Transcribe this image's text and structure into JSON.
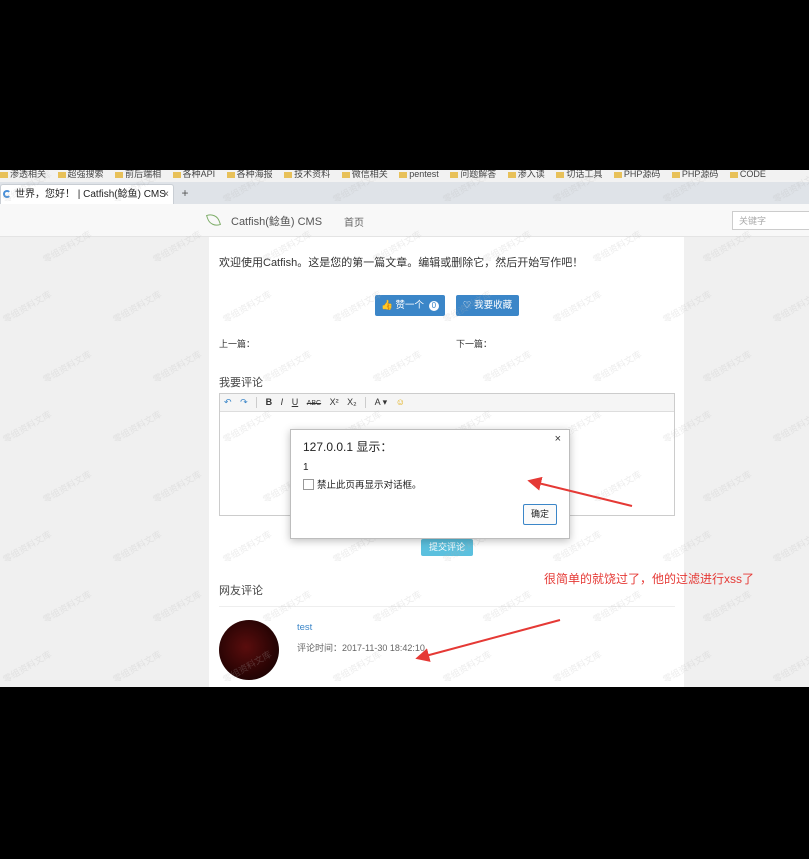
{
  "browser": {
    "bookmarks": [
      "渗透相关",
      "超强搜索",
      "前后端相",
      "各种API",
      "各种海报",
      "技术资料",
      "微信相关",
      "pentest",
      "问题解答",
      "渗入读",
      "切话工具",
      "PHP源码",
      "PHP源码",
      "CODE"
    ],
    "tab_title": "世界，您好！ | Catfish(鲶鱼) CMS",
    "tab_close": "×",
    "new_tab": "+"
  },
  "navbar": {
    "brand": "Catfish(鲶鱼) CMS",
    "home": "首页",
    "search_placeholder": "关键字"
  },
  "article": {
    "welcome_text": "欢迎使用Catfish。这是您的第一篇文章。编辑或删除它，然后开始写作吧！",
    "like_label": "赞一个",
    "like_count": "0",
    "favorite_label": "我要收藏",
    "prev_label": "上一篇：",
    "next_label": "下一篇："
  },
  "comment_form": {
    "heading": "我要评论",
    "toolbar": [
      "↶",
      "↷",
      "B",
      "I",
      "U",
      "ABC",
      "X²",
      "X₂",
      "A ▾",
      "☺"
    ],
    "submit_label": "提交评论"
  },
  "comments": {
    "heading": "网友评论",
    "items": [
      {
        "user": "test",
        "time": "评论时间：2017-11-30 18:42:10"
      }
    ]
  },
  "dialog": {
    "title": "127.0.0.1 显示：",
    "message": "1",
    "checkbox_label": "禁止此页再显示对话框。",
    "ok_label": "确定",
    "close": "×"
  },
  "annotation": {
    "text": "很简单的就饶过了，他的过滤进行xss了",
    "color": "#e53935"
  },
  "watermark": "零组资料文库",
  "colors": {
    "primary": "#3b86c8",
    "info": "#5bc0de",
    "annotation": "#e53935"
  }
}
